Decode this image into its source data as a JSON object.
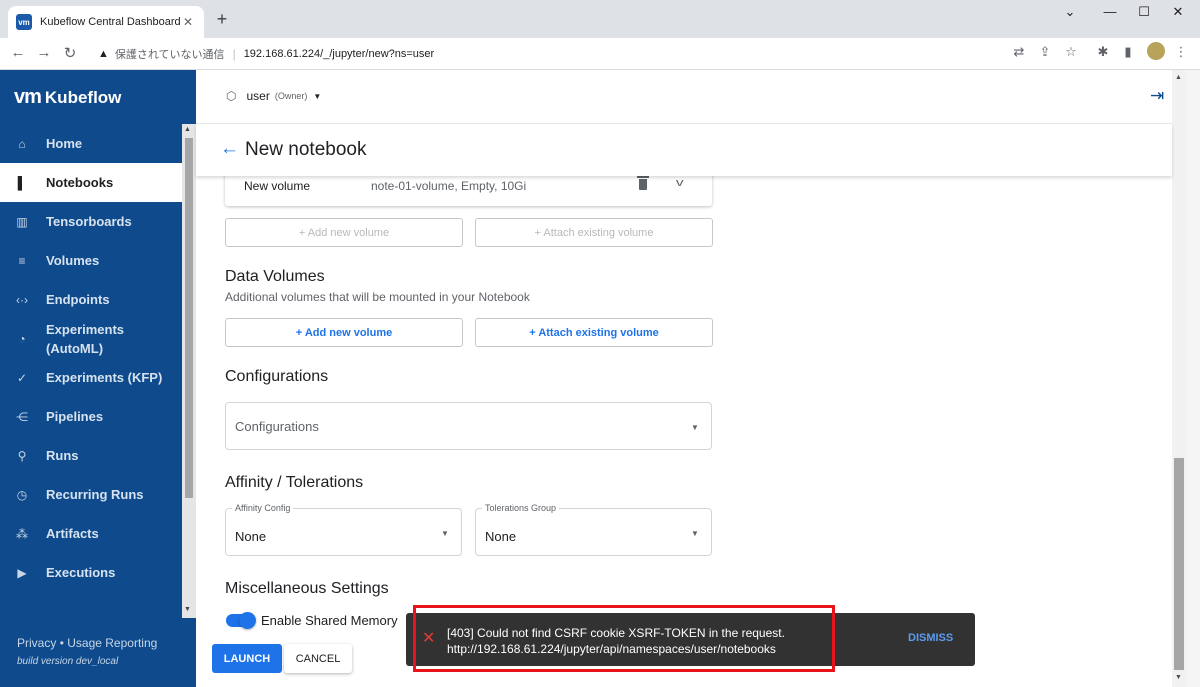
{
  "browser": {
    "tab_title": "Kubeflow Central Dashboard",
    "tab_favicon": "vm",
    "omnibox_warning": "保護されていない通信",
    "url": "192.168.61.224/_/jupyter/new?ns=user"
  },
  "sidebar": {
    "brand_vm": "vm",
    "brand_name": "Kubeflow",
    "items": [
      {
        "label": "Home",
        "icon": "home-icon"
      },
      {
        "label": "Notebooks",
        "icon": "notebook-icon",
        "active": true
      },
      {
        "label": "Tensorboards",
        "icon": "chart-icon"
      },
      {
        "label": "Volumes",
        "icon": "storage-icon"
      },
      {
        "label": "Endpoints",
        "icon": "code-icon"
      },
      {
        "label": "Experiments (AutoML)",
        "icon": "speed-icon"
      },
      {
        "label": "Experiments (KFP)",
        "icon": "check-all-icon"
      },
      {
        "label": "Pipelines",
        "icon": "pipeline-icon"
      },
      {
        "label": "Runs",
        "icon": "run-icon"
      },
      {
        "label": "Recurring Runs",
        "icon": "alarm-icon"
      },
      {
        "label": "Artifacts",
        "icon": "bubble-icon"
      },
      {
        "label": "Executions",
        "icon": "play-icon"
      }
    ],
    "footer_privacy": "Privacy",
    "footer_sep": "•",
    "footer_usage": "Usage Reporting",
    "build_version": "build version dev_local"
  },
  "topbar": {
    "namespace": "user",
    "role": "(Owner)"
  },
  "page": {
    "title": "New notebook"
  },
  "workspace_volume": {
    "name": "New volume",
    "description": "note-01-volume, Empty, 10Gi",
    "add_new": "+ Add new volume",
    "attach_existing": "+ Attach existing volume"
  },
  "data_volumes": {
    "title": "Data Volumes",
    "subtitle": "Additional volumes that will be mounted in your Notebook",
    "add_new": "+ Add new volume",
    "attach_existing": "+ Attach existing volume"
  },
  "configurations": {
    "title": "Configurations",
    "placeholder": "Configurations"
  },
  "affinity": {
    "title": "Affinity / Tolerations",
    "affinity_label": "Affinity Config",
    "affinity_value": "None",
    "tolerations_label": "Tolerations Group",
    "tolerations_value": "None"
  },
  "misc": {
    "title": "Miscellaneous Settings",
    "shared_memory_label": "Enable Shared Memory",
    "shared_memory_enabled": true
  },
  "actions": {
    "launch": "LAUNCH",
    "cancel": "CANCEL"
  },
  "snackbar": {
    "line1": "[403] Could not find CSRF cookie XSRF-TOKEN in the request.",
    "line2": "http://192.168.61.224/jupyter/api/namespaces/user/notebooks",
    "dismiss": "DISMISS",
    "error_color": "#e53935"
  },
  "colors": {
    "sidebar": "#0f4b8c",
    "accent": "#1e73e8",
    "highlight": "#e8141b"
  }
}
